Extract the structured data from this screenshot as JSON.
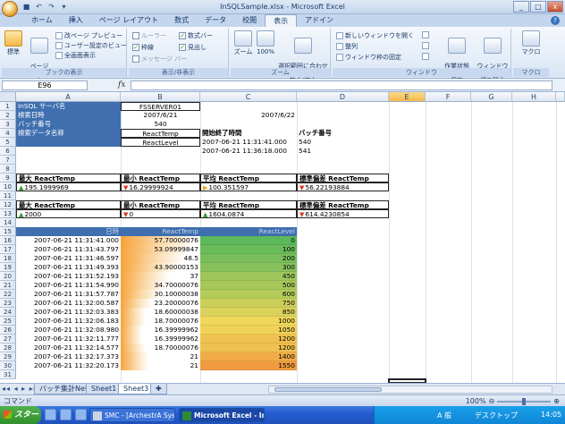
{
  "window": {
    "title": "InSQLSample.xlsx - Microsoft Excel",
    "minimize": "_",
    "maximize": "□",
    "close": "x"
  },
  "ribbon_tabs": [
    "ホーム",
    "挿入",
    "ページ レイアウト",
    "数式",
    "データ",
    "校閲",
    "表示",
    "アドイン"
  ],
  "active_tab": "表示",
  "ribbon": {
    "group1": {
      "label": "ブックの表示",
      "normal": "標準",
      "page_layout": "ページ\nレイアウト",
      "page_break": "改ページ プレビュー",
      "custom_view": "ユーザー設定のビュー",
      "full_screen": "全画面表示"
    },
    "group2": {
      "label": "表示/非表示",
      "ruler": "ルーラー",
      "gridlines": "枠線",
      "message_bar": "メッセージ バー",
      "formula_bar": "数式バー",
      "headings": "見出し"
    },
    "group3": {
      "label": "ズーム",
      "zoom": "ズーム",
      "zoom100": "100%",
      "zoom_selection": "選択範囲に合わせて\n拡大/縮小"
    },
    "group4": {
      "label": "ウィンドウ",
      "new_window": "新しいウィンドウを開く",
      "arrange": "整列",
      "freeze": "ウィンドウ枠の固定",
      "save_workspace": "作業状態の\n保存",
      "switch_windows": "ウィンドウの\n切り替え"
    },
    "group5": {
      "label": "マクロ",
      "macros": "マクロ"
    }
  },
  "formula_bar": {
    "name_box": "E96",
    "fx": "fx",
    "value": ""
  },
  "columns": [
    "A",
    "B",
    "C",
    "D",
    "E",
    "F",
    "G",
    "H"
  ],
  "selected_column": "E",
  "rows": [
    "1",
    "2",
    "3",
    "4",
    "5",
    "6",
    "7",
    "8",
    "9",
    "10",
    "11",
    "12",
    "13",
    "14",
    "15",
    "16",
    "17",
    "18",
    "19",
    "20",
    "21",
    "22",
    "23",
    "24",
    "25",
    "26",
    "27",
    "28",
    "29",
    "30",
    "31"
  ],
  "info": {
    "server_label": "InSQL サーバ名",
    "server_value": "FSSERVER01",
    "date_label": "検索日時",
    "date_from": "2007/6/21",
    "date_to": "2007/6/22",
    "batch_label": "バッチ番号",
    "batch_value": "540",
    "data_label": "検索データ名称",
    "data_value1": "ReactTemp",
    "data_value2": "ReactLevel",
    "period_header": "開始終了時間",
    "batch_header": "バッチ番号",
    "time1": "2007-06-21 11:31:41.000",
    "batch1": "540",
    "time2": "2007-06-21 11:36:18.000",
    "batch2": "541"
  },
  "stats1": {
    "h_max": "最大 ReactTemp",
    "h_min": "最小 ReactTemp",
    "h_avg": "平均 ReactTemp",
    "h_std": "標準偏差 ReactTemp",
    "max": "195.1999969",
    "min": "16.29999924",
    "avg": "100.351597",
    "std": "56.22193884"
  },
  "stats2": {
    "h_max": "最大 ReactTemp",
    "h_min": "最小 ReactTemp",
    "h_avg": "平均 ReactTemp",
    "h_std": "標準偏差 ReactTemp",
    "max": "2000",
    "min": "0",
    "avg": "1604.0874",
    "std": "614.4230854"
  },
  "table": {
    "headers": [
      "日時",
      "ReactTemp",
      "ReactLevel"
    ],
    "rows": [
      [
        "2007-06-21 11:31:41.000",
        "57.70000076",
        "0"
      ],
      [
        "2007-06-21 11:31:43.797",
        "53.09999847",
        "100"
      ],
      [
        "2007-06-21 11:31:46.597",
        "48.5",
        "200"
      ],
      [
        "2007-06-21 11:31:49.393",
        "43.90000153",
        "300"
      ],
      [
        "2007-06-21 11:31:52.193",
        "37",
        "450"
      ],
      [
        "2007-06-21 11:31:54.990",
        "34.70000076",
        "500"
      ],
      [
        "2007-06-21 11:31:57.787",
        "30.10000038",
        "600"
      ],
      [
        "2007-06-21 11:32:00.587",
        "23.20000076",
        "750"
      ],
      [
        "2007-06-21 11:32:03.383",
        "18.60000038",
        "850"
      ],
      [
        "2007-06-21 11:32:06.183",
        "18.70000076",
        "1000"
      ],
      [
        "2007-06-21 11:32:08.980",
        "16.39999962",
        "1050"
      ],
      [
        "2007-06-21 11:32:11.777",
        "16.39999962",
        "1200"
      ],
      [
        "2007-06-21 11:32:14.577",
        "18.70000076",
        "1200"
      ],
      [
        "2007-06-21 11:32:17.373",
        "21",
        "1400"
      ],
      [
        "2007-06-21 11:32:20.173",
        "21",
        "1550"
      ]
    ]
  },
  "sheets": [
    "バッチ集計New",
    "Sheet1",
    "Sheet3"
  ],
  "active_sheet": "Sheet3",
  "status": {
    "mode": "コマンド",
    "zoom": "100%"
  },
  "taskbar": {
    "start": "スタート",
    "item1": "SMC - [ArchestrA Syst...",
    "item2": "Microsoft Excel - In...",
    "ime": "A 般",
    "desktop": "デスクトップ",
    "clock": "14:05"
  },
  "colors": {
    "header_navy": "#3f6fae",
    "temp_bar": "#f7a33a",
    "level_low": "#5bb85b",
    "level_high": "#f06a2a"
  }
}
